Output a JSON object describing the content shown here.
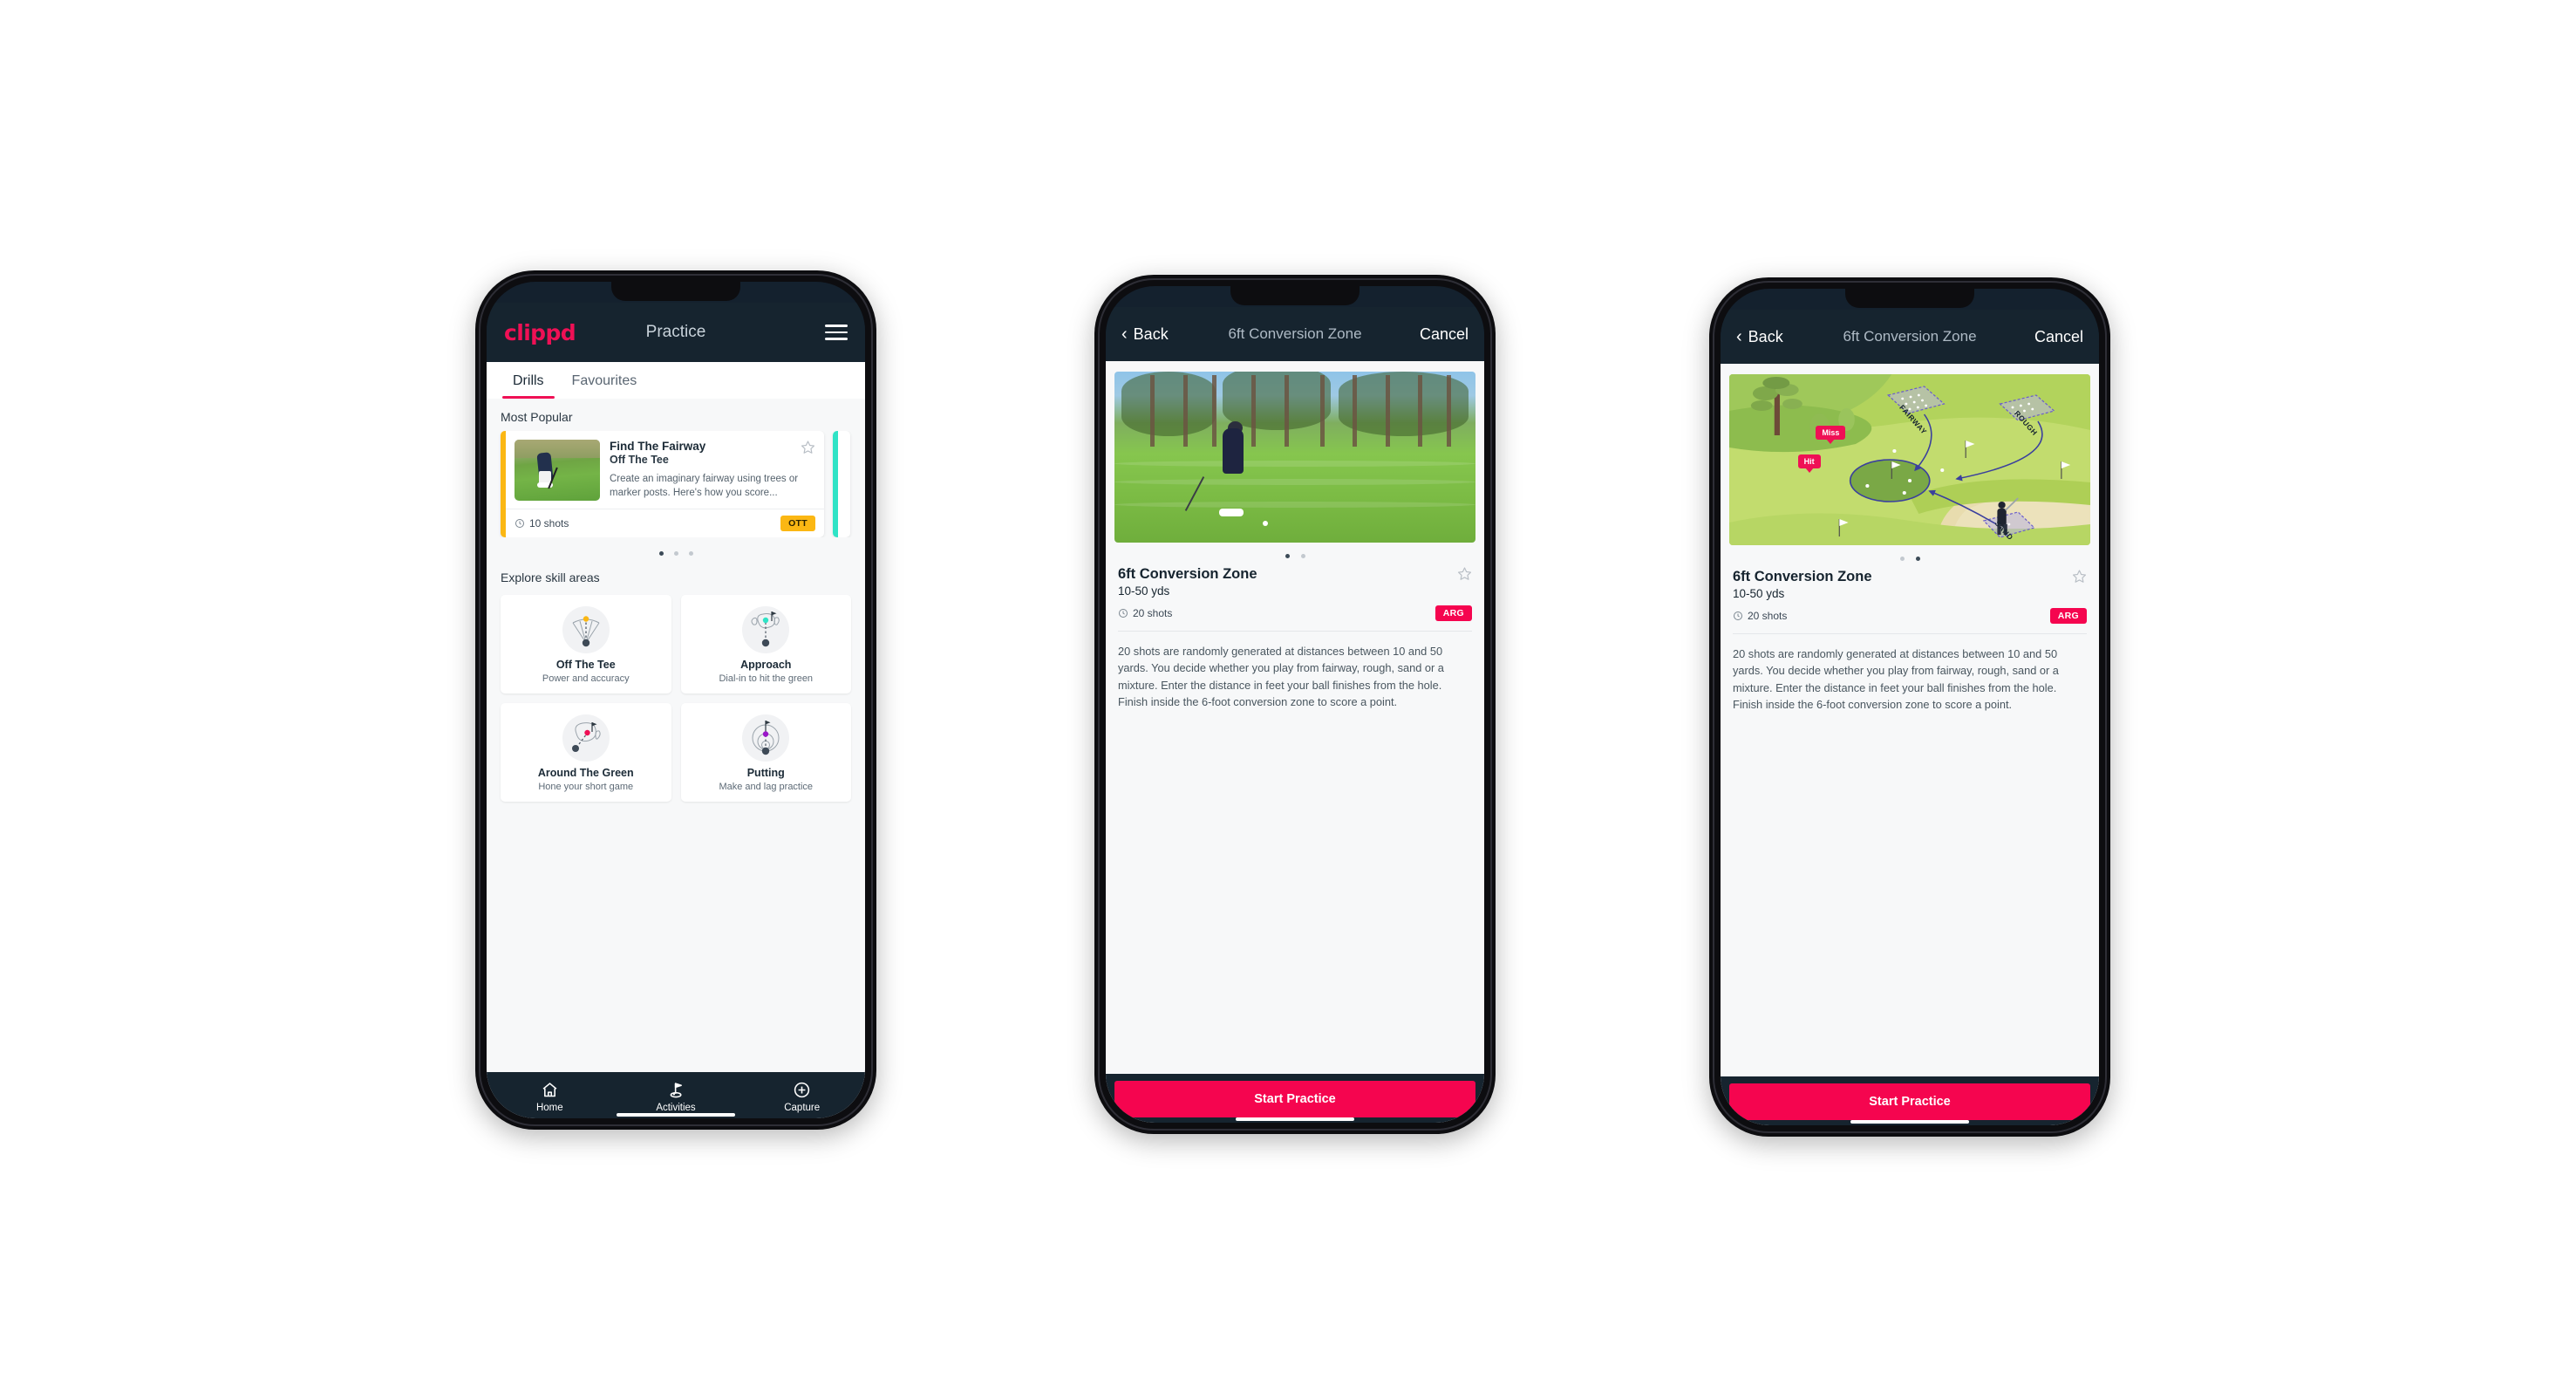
{
  "phone1": {
    "appbar": {
      "logo": "clippd",
      "title": "Practice",
      "menu_icon": "hamburger-icon"
    },
    "tabs": [
      {
        "label": "Drills",
        "active": true
      },
      {
        "label": "Favourites",
        "active": false
      }
    ],
    "section_popular": "Most Popular",
    "featured_card": {
      "title": "Find The Fairway",
      "subtitle": "Off The Tee",
      "description": "Create an imaginary fairway using trees or marker posts. Here's how you score...",
      "shots": "10 shots",
      "badge": "OTT",
      "badge_color": "#fbb713",
      "stripe_color": "#fbb713",
      "next_stripe_color": "#2fe3c6",
      "star_icon": "star-outline-icon",
      "clock_icon": "clock-icon"
    },
    "carousel_dots": {
      "count": 3,
      "active_index": 0
    },
    "section_skills": "Explore skill areas",
    "skills": [
      {
        "name": "Off The Tee",
        "desc": "Power and accuracy",
        "icon": "tee-fan-icon",
        "accent": "#fbb713"
      },
      {
        "name": "Approach",
        "desc": "Dial-in to hit the green",
        "icon": "approach-green-icon",
        "accent": "#2fe3c6"
      },
      {
        "name": "Around The Green",
        "desc": "Hone your short game",
        "icon": "chip-green-icon",
        "accent": "#ef1055"
      },
      {
        "name": "Putting",
        "desc": "Make and lag practice",
        "icon": "putt-rings-icon",
        "accent": "#9b17c9"
      }
    ],
    "tabbar": [
      {
        "label": "Home",
        "icon": "home-icon",
        "active": false
      },
      {
        "label": "Activities",
        "icon": "golf-flag-icon",
        "active": true
      },
      {
        "label": "Capture",
        "icon": "plus-circle-icon",
        "active": false
      }
    ]
  },
  "phone2": {
    "navbar": {
      "back": "Back",
      "title": "6ft Conversion Zone",
      "cancel": "Cancel",
      "back_icon": "chevron-left-icon"
    },
    "hero_type": "photo",
    "hero_alt": "golfer-chipping-photo",
    "carousel_dots": {
      "count": 2,
      "active_index": 0
    },
    "detail": {
      "title": "6ft Conversion Zone",
      "yards": "10-50 yds",
      "shots": "20 shots",
      "badge": "ARG",
      "badge_color": "#f5054f",
      "star_icon": "star-outline-icon",
      "clock_icon": "clock-icon",
      "body": "20 shots are randomly generated at distances between 10 and 50 yards. You decide whether you play from fairway, rough, sand or a mixture. Enter the distance in feet your ball finishes from the hole. Finish inside the 6-foot conversion zone to score a point."
    },
    "cta": "Start Practice"
  },
  "phone3": {
    "navbar": {
      "back": "Back",
      "title": "6ft Conversion Zone",
      "cancel": "Cancel",
      "back_icon": "chevron-left-icon"
    },
    "hero_type": "illustration",
    "hero_alt": "golf-course-diagram",
    "illustration": {
      "zones": [
        "FAIRWAY",
        "ROUGH",
        "SAND"
      ],
      "markers": [
        {
          "label": "Miss",
          "color": "#ef1055"
        },
        {
          "label": "Hit",
          "color": "#ef1055"
        }
      ]
    },
    "carousel_dots": {
      "count": 2,
      "active_index": 1
    },
    "detail": {
      "title": "6ft Conversion Zone",
      "yards": "10-50 yds",
      "shots": "20 shots",
      "badge": "ARG",
      "badge_color": "#f5054f",
      "star_icon": "star-outline-icon",
      "clock_icon": "clock-icon",
      "body": "20 shots are randomly generated at distances between 10 and 50 yards. You decide whether you play from fairway, rough, sand or a mixture. Enter the distance in feet your ball finishes from the hole. Finish inside the 6-foot conversion zone to score a point."
    },
    "cta": "Start Practice"
  }
}
